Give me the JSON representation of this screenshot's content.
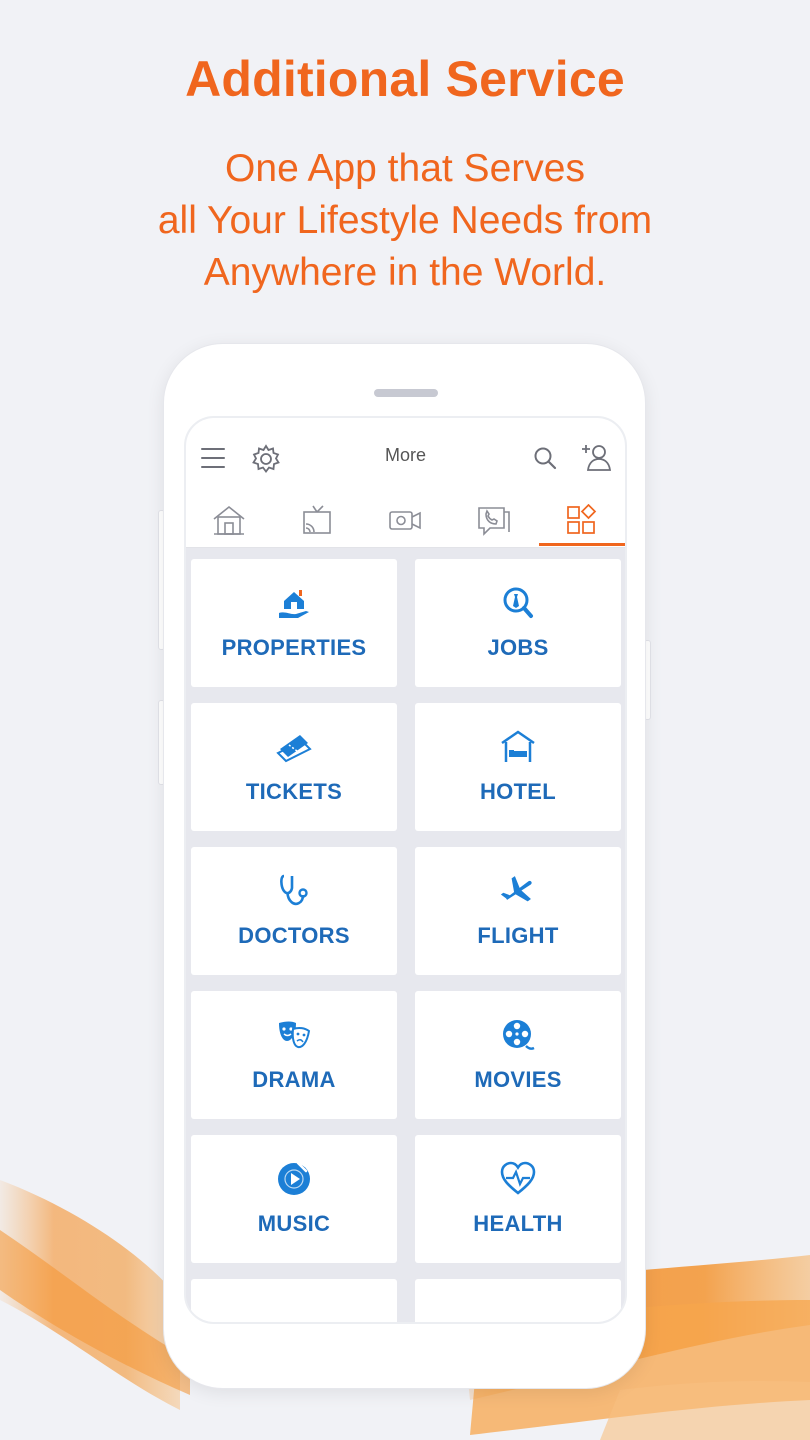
{
  "headline": "Additional Service",
  "subline": [
    "One App that Serves",
    "all Your Lifestyle Needs from",
    "Anywhere in the World."
  ],
  "colors": {
    "accent": "#f0661e",
    "label_blue": "#1e6ab8",
    "icon_blue": "#1c7fd6"
  },
  "app": {
    "title": "More",
    "toolbar_icons": [
      "menu-icon",
      "settings-icon",
      "search-icon",
      "add-user-icon"
    ],
    "tabs": [
      {
        "icon": "home-icon",
        "active": false
      },
      {
        "icon": "tv-icon",
        "active": false
      },
      {
        "icon": "video-icon",
        "active": false
      },
      {
        "icon": "call-icon",
        "active": false
      },
      {
        "icon": "apps-icon",
        "active": true
      }
    ],
    "services": [
      {
        "label": "PROPERTIES",
        "icon": "house-hand-icon"
      },
      {
        "label": "JOBS",
        "icon": "job-search-icon"
      },
      {
        "label": "TICKETS",
        "icon": "ticket-icon"
      },
      {
        "label": "HOTEL",
        "icon": "hotel-bed-icon"
      },
      {
        "label": "DOCTORS",
        "icon": "stethoscope-icon"
      },
      {
        "label": "FLIGHT",
        "icon": "airplane-icon"
      },
      {
        "label": "DRAMA",
        "icon": "theater-masks-icon"
      },
      {
        "label": "MOVIES",
        "icon": "film-reel-icon"
      },
      {
        "label": "MUSIC",
        "icon": "music-disc-icon"
      },
      {
        "label": "HEALTH",
        "icon": "heart-pulse-icon"
      },
      {
        "label": "",
        "icon": "car-icon"
      },
      {
        "label": "",
        "icon": "sun-icon"
      }
    ]
  }
}
